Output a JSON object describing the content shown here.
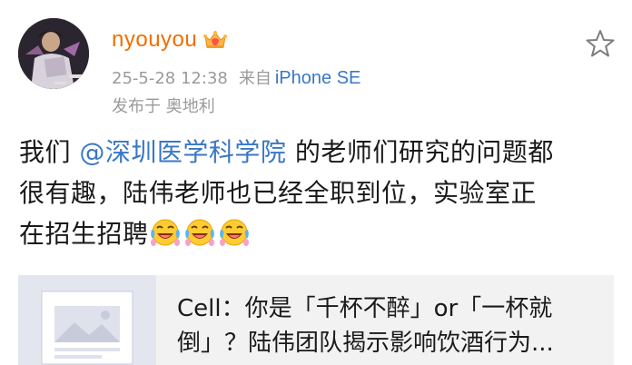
{
  "post": {
    "username": "nyouyou",
    "timestamp": "25-5-28 12:38",
    "source_prefix": "来自",
    "device": "iPhone SE",
    "location": "发布于 奥地利",
    "icons": {
      "avatar": "avatar-image",
      "badge": "vip-crown-badge-icon",
      "favorite": "star-outline-icon",
      "emoji": "crying-laughing-emoji-icon"
    },
    "colors": {
      "username": "#f26d00",
      "link": "#3a77c5",
      "meta": "#9a9a9a"
    }
  },
  "body": {
    "pre_mention": "我们 ",
    "mention": "@深圳医学科学院",
    "line1_post": " 的老师们研究的问题都",
    "line2": "很有趣，陆伟老师也已经全职到位，实验室正",
    "line3": "在招生招聘"
  },
  "card": {
    "title_line1": "Cell：你是「千杯不醉」or「一杯就",
    "title_line2": "倒」？陆伟团队揭示影响饮酒行为...",
    "thumbnail": "article-placeholder-icon"
  }
}
